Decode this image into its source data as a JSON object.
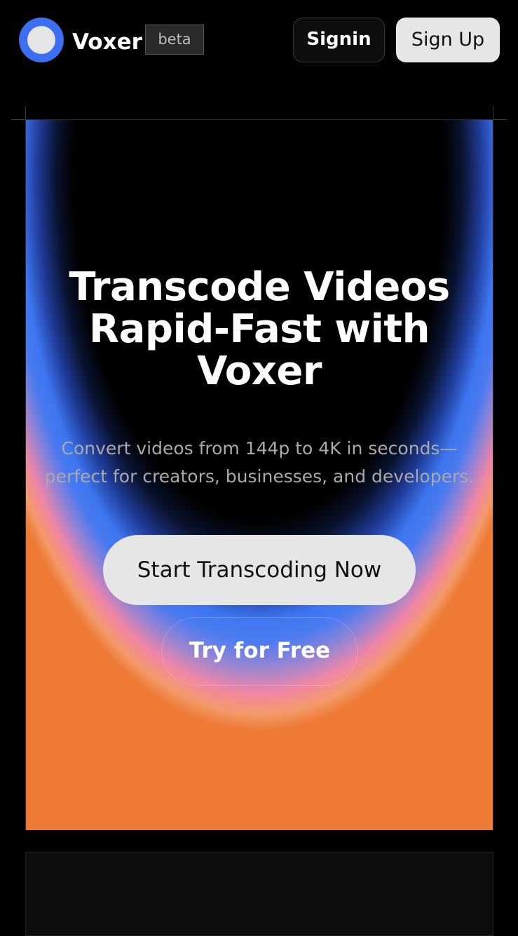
{
  "header": {
    "brand": "Voxer",
    "badge": "beta",
    "signin_label": "Signin",
    "signup_label": "Sign Up"
  },
  "hero": {
    "title_lines": [
      "Transcode Videos",
      "Rapid-Fast with",
      "Voxer"
    ],
    "subtitle_lines": [
      "Convert videos from 144p to 4K in seconds—",
      "perfect for creators, businesses, and developers."
    ],
    "primary_cta": "Start Transcoding Now",
    "secondary_cta": "Try for Free"
  },
  "colors": {
    "accent_blue": "#3b6ff0",
    "gradient_pink": "#ef85a5",
    "gradient_orange": "#ee7a36",
    "button_light": "#e6e6e6"
  }
}
